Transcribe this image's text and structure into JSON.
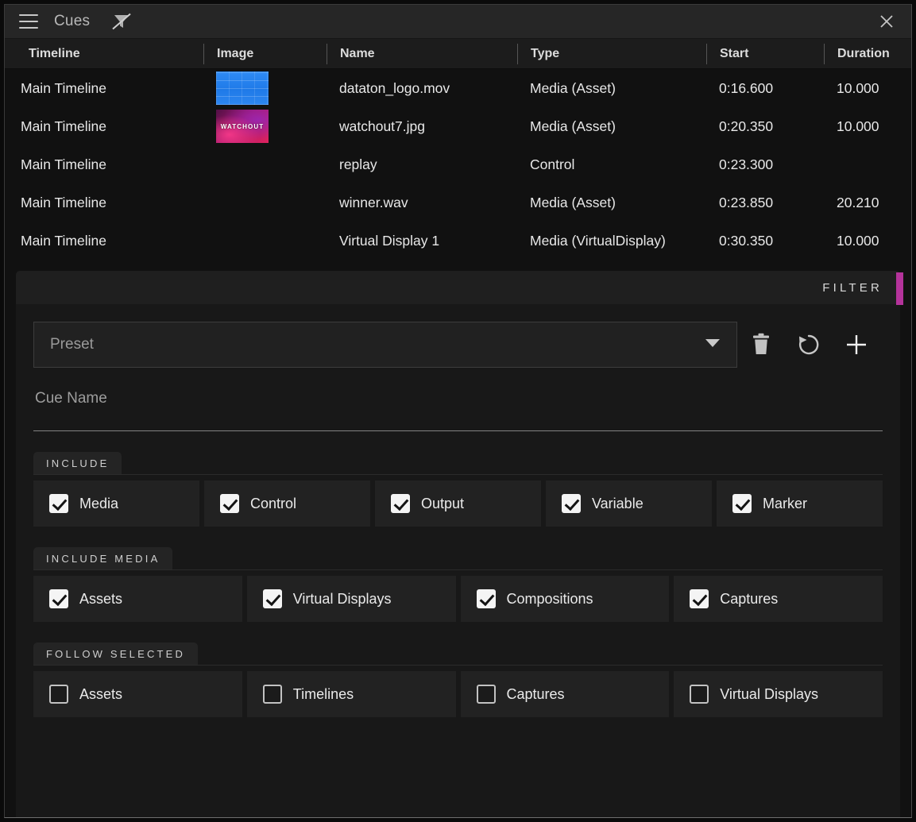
{
  "window": {
    "title": "Cues",
    "menu_icon": "hamburger-icon",
    "filter_toggle_icon": "funnel-slash-icon",
    "close_icon": "close-icon"
  },
  "table": {
    "columns": [
      "Timeline",
      "Image",
      "Name",
      "Type",
      "Start",
      "Duration"
    ],
    "rows": [
      {
        "timeline": "Main Timeline",
        "thumb": "blue-tile-logo",
        "thumb_caption": "",
        "name": "dataton_logo.mov",
        "type": "Media (Asset)",
        "start": "0:16.600",
        "duration": "10.000"
      },
      {
        "timeline": "Main Timeline",
        "thumb": "watchout-magenta",
        "thumb_caption": "WATCHOUT",
        "name": "watchout7.jpg",
        "type": "Media (Asset)",
        "start": "0:20.350",
        "duration": "10.000"
      },
      {
        "timeline": "Main Timeline",
        "thumb": "",
        "thumb_caption": "",
        "name": "replay",
        "type": "Control",
        "start": "0:23.300",
        "duration": ""
      },
      {
        "timeline": "Main Timeline",
        "thumb": "",
        "thumb_caption": "",
        "name": "winner.wav",
        "type": "Media (Asset)",
        "start": "0:23.850",
        "duration": "20.210"
      },
      {
        "timeline": "Main Timeline",
        "thumb": "",
        "thumb_caption": "",
        "name": "Virtual Display 1",
        "type": "Media (VirtualDisplay)",
        "start": "0:30.350",
        "duration": "10.000"
      }
    ]
  },
  "filter": {
    "header_label": "FILTER",
    "accent_color": "#b4339b",
    "preset": {
      "placeholder": "Preset",
      "value": "",
      "chevron_icon": "chevron-down-icon"
    },
    "actions": [
      {
        "name": "delete-preset-button",
        "icon": "trash-icon"
      },
      {
        "name": "reset-preset-button",
        "icon": "revert-icon"
      },
      {
        "name": "add-preset-button",
        "icon": "plus-icon"
      }
    ],
    "cue_name": {
      "placeholder": "Cue Name",
      "value": ""
    },
    "sections": [
      {
        "title": "INCLUDE",
        "items": [
          {
            "label": "Media",
            "checked": true
          },
          {
            "label": "Control",
            "checked": true
          },
          {
            "label": "Output",
            "checked": true
          },
          {
            "label": "Variable",
            "checked": true
          },
          {
            "label": "Marker",
            "checked": true
          }
        ]
      },
      {
        "title": "INCLUDE MEDIA",
        "items": [
          {
            "label": "Assets",
            "checked": true
          },
          {
            "label": "Virtual Displays",
            "checked": true
          },
          {
            "label": "Compositions",
            "checked": true
          },
          {
            "label": "Captures",
            "checked": true
          }
        ]
      },
      {
        "title": "FOLLOW SELECTED",
        "items": [
          {
            "label": "Assets",
            "checked": false
          },
          {
            "label": "Timelines",
            "checked": false
          },
          {
            "label": "Captures",
            "checked": false
          },
          {
            "label": "Virtual Displays",
            "checked": false
          }
        ]
      }
    ]
  }
}
